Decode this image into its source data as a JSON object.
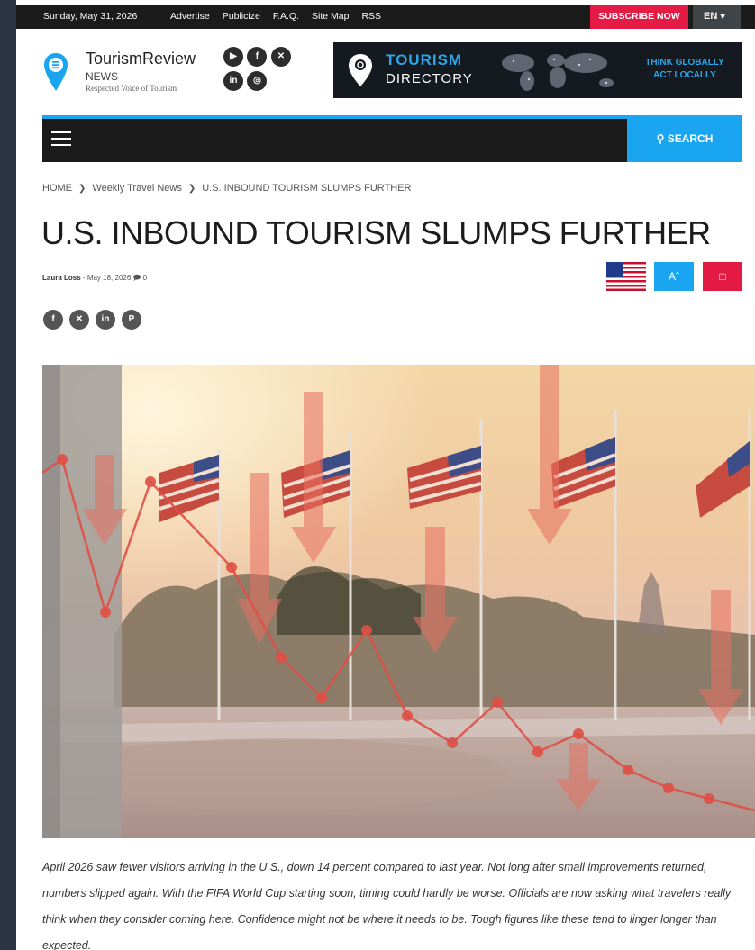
{
  "topbar": {
    "date": "Sunday, May 31, 2026",
    "links": [
      "Advertise",
      "Publicize",
      "F.A.Q.",
      "Site Map",
      "RSS"
    ],
    "subscribe": "SUBSCRIBE NOW",
    "language": "EN ▾"
  },
  "header": {
    "brand_name": "TourismReview",
    "brand_news": "NEWS",
    "brand_tagline": "Respected Voice of Tourism",
    "social": [
      "youtube-icon",
      "facebook-icon",
      "x-icon",
      "linkedin-icon",
      "instagram-icon"
    ],
    "banner": {
      "title": "TOURISM",
      "subtitle": "DIRECTORY",
      "slogan_line1": "THINK GLOBALLY",
      "slogan_line2": "ACT LOCALLY"
    }
  },
  "nav": {
    "search_label": "SEARCH"
  },
  "breadcrumb": {
    "items": [
      "HOME",
      "Weekly Travel News",
      "U.S. INBOUND TOURISM SLUMPS FURTHER"
    ]
  },
  "article": {
    "title": "U.S. INBOUND TOURISM SLUMPS FURTHER",
    "author": "Laura Loss",
    "date": "May 18, 2026",
    "comments": "0",
    "body": "April 2026 saw fewer visitors arriving in the U.S., down 14 percent compared to last year. Not long after small improvements returned, numbers slipped again. With the FIFA World Cup starting soon, timing could hardly be worse. Officials are now asking what travelers really think when they consider coming here. Confidence might not be where it needs to be. Tough figures like these tend to linger longer than expected."
  },
  "colors": {
    "accent": "#1aa5f0",
    "subscribe": "#e41b45",
    "topbar": "#1b1b1b"
  }
}
